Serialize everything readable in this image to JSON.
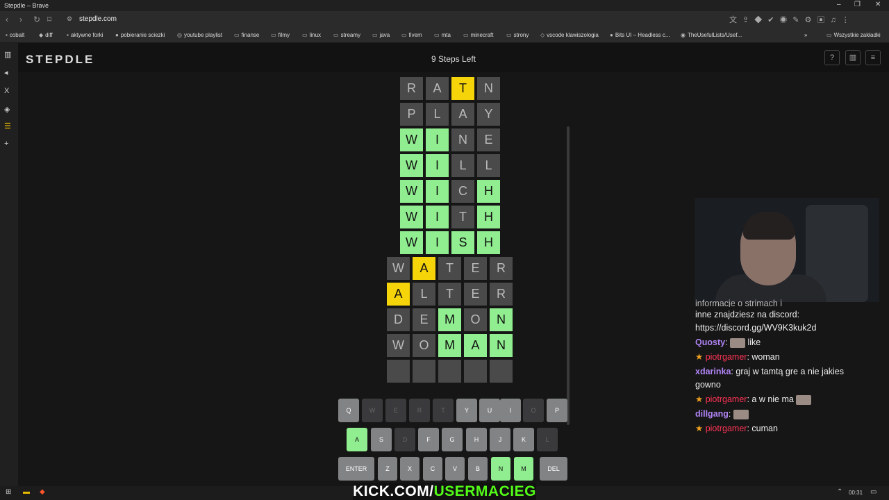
{
  "window": {
    "title": "Stepdle – Brave"
  },
  "browser": {
    "url": "stepdle.com",
    "bookmarks": [
      "cobalt",
      "diff",
      "aktywne forki",
      "pobieranie sciezki",
      "youtube playlist",
      "finanse",
      "filmy",
      "linux",
      "streamy",
      "java",
      "fivem",
      "mta",
      "minecraft",
      "strony",
      "vscode klawiszologia",
      "Bits UI – Headless c...",
      "TheUsefulLists/Usef...",
      "Wszystkie zakładki"
    ]
  },
  "app": {
    "logo": "STEPDLE",
    "steps_left": "9 Steps Left"
  },
  "board": {
    "rows": [
      {
        "letters": [
          "R",
          "A",
          "T",
          "N"
        ],
        "states": [
          "gr",
          "gr",
          "y",
          "gr"
        ]
      },
      {
        "letters": [
          "P",
          "L",
          "A",
          "Y"
        ],
        "states": [
          "gr",
          "gr",
          "gr",
          "gr"
        ]
      },
      {
        "letters": [
          "W",
          "I",
          "N",
          "E"
        ],
        "states": [
          "g",
          "g",
          "gr",
          "gr"
        ]
      },
      {
        "letters": [
          "W",
          "I",
          "L",
          "L"
        ],
        "states": [
          "g",
          "g",
          "gr",
          "gr"
        ]
      },
      {
        "letters": [
          "W",
          "I",
          "C",
          "H"
        ],
        "states": [
          "g",
          "g",
          "gr",
          "g"
        ]
      },
      {
        "letters": [
          "W",
          "I",
          "T",
          "H"
        ],
        "states": [
          "g",
          "g",
          "gr",
          "g"
        ]
      },
      {
        "letters": [
          "W",
          "I",
          "S",
          "H"
        ],
        "states": [
          "g",
          "g",
          "g",
          "g"
        ]
      },
      {
        "letters": [
          "W",
          "A",
          "T",
          "E",
          "R"
        ],
        "states": [
          "gr",
          "y",
          "gr",
          "gr",
          "gr"
        ]
      },
      {
        "letters": [
          "A",
          "L",
          "T",
          "E",
          "R"
        ],
        "states": [
          "y",
          "gr",
          "gr",
          "gr",
          "gr"
        ]
      },
      {
        "letters": [
          "D",
          "E",
          "M",
          "O",
          "N"
        ],
        "states": [
          "gr",
          "gr",
          "g",
          "gr",
          "g"
        ]
      },
      {
        "letters": [
          "W",
          "O",
          "M",
          "A",
          "N"
        ],
        "states": [
          "gr",
          "gr",
          "g",
          "g",
          "g"
        ]
      },
      {
        "letters": [
          "",
          "",
          "",
          "",
          ""
        ],
        "states": [
          "em",
          "em",
          "em",
          "em",
          "em"
        ]
      }
    ]
  },
  "keyboard": {
    "row1": [
      {
        "k": "Q",
        "s": "n"
      },
      {
        "k": "W",
        "s": "d"
      },
      {
        "k": "E",
        "s": "d"
      },
      {
        "k": "R",
        "s": "d"
      },
      {
        "k": "T",
        "s": "d"
      },
      {
        "k": "Y",
        "s": "n"
      },
      {
        "k": "U",
        "s": "n"
      },
      {
        "k": "I",
        "s": "n"
      },
      {
        "k": "O",
        "s": "d"
      },
      {
        "k": "P",
        "s": "n"
      }
    ],
    "row2": [
      {
        "k": "A",
        "s": "g"
      },
      {
        "k": "S",
        "s": "n"
      },
      {
        "k": "D",
        "s": "d"
      },
      {
        "k": "F",
        "s": "n"
      },
      {
        "k": "G",
        "s": "n"
      },
      {
        "k": "H",
        "s": "n"
      },
      {
        "k": "J",
        "s": "n"
      },
      {
        "k": "K",
        "s": "n"
      },
      {
        "k": "L",
        "s": "d"
      }
    ],
    "row3": [
      {
        "k": "ENTER",
        "s": "n"
      },
      {
        "k": "Z",
        "s": "n"
      },
      {
        "k": "X",
        "s": "n"
      },
      {
        "k": "C",
        "s": "n"
      },
      {
        "k": "V",
        "s": "n"
      },
      {
        "k": "B",
        "s": "n"
      },
      {
        "k": "N",
        "s": "g"
      },
      {
        "k": "M",
        "s": "g"
      },
      {
        "k": "DEL",
        "s": "n"
      }
    ]
  },
  "chat": {
    "cut_line": "informacje o strimach i",
    "m0": "inne znajdziesz na discord:",
    "m0b": "https://discord.gg/WV9K3kuk2d",
    "m1_user": "Quosty",
    "m1_text": " like",
    "m2_user": "piotrgamer",
    "m2_text": ": woman",
    "m3_user": "xdarinka",
    "m3_text": ": graj w tamtą gre a nie jakies gowno",
    "m4_user": "piotrgamer",
    "m4_text": ": a w nie ma",
    "m5_user": "dillgang",
    "m5_text": ":",
    "m6_user": "piotrgamer",
    "m6_text": ": cuman"
  },
  "overlay": {
    "kick_a": "KICK.COM/",
    "kick_b": "USERMACIEG"
  },
  "taskbar": {
    "time": "00:31"
  }
}
